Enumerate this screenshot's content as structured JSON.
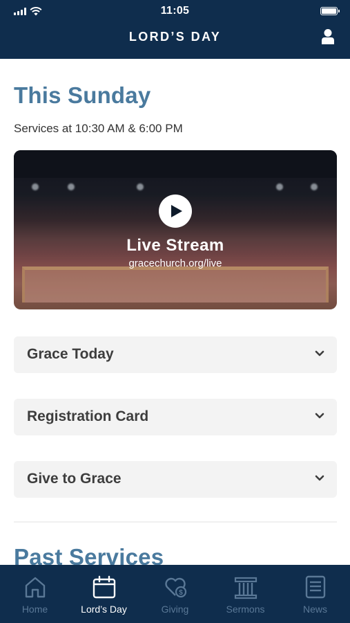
{
  "status_bar": {
    "time": "11:05"
  },
  "header": {
    "title": "LORD’S DAY"
  },
  "this_sunday": {
    "title": "This Sunday",
    "subtitle": "Services at 10:30 AM & 6:00 PM",
    "live_stream": {
      "title": "Live Stream",
      "url": "gracechurch.org/live"
    }
  },
  "accordions": [
    {
      "label": "Grace Today"
    },
    {
      "label": "Registration Card"
    },
    {
      "label": "Give to Grace"
    }
  ],
  "past_services": {
    "title": "Past Services"
  },
  "tabbar": {
    "items": [
      {
        "label": "Home",
        "icon": "home-icon",
        "active": false
      },
      {
        "label": "Lord’s Day",
        "icon": "calendar-icon",
        "active": true
      },
      {
        "label": "Giving",
        "icon": "heart-dollar-icon",
        "active": false
      },
      {
        "label": "Sermons",
        "icon": "pillars-icon",
        "active": false
      },
      {
        "label": "News",
        "icon": "news-icon",
        "active": false
      }
    ]
  },
  "colors": {
    "navy": "#0f2d4d",
    "accent_blue": "#4a7a9e",
    "tab_inactive": "#5a7896",
    "card_bg": "#f3f3f3"
  }
}
